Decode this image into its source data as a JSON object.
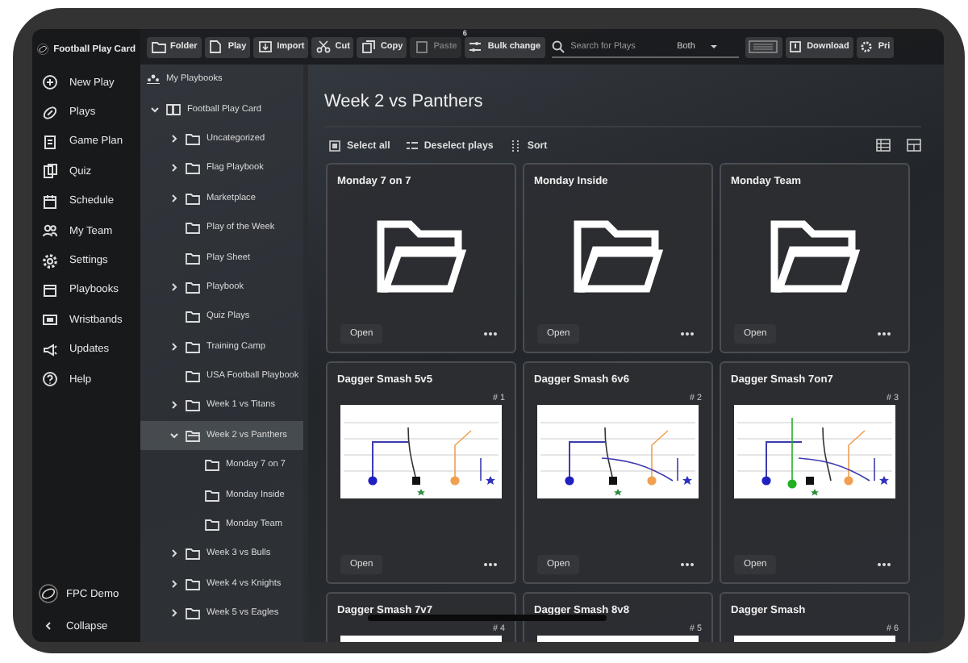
{
  "app": {
    "title": "Football Play Card"
  },
  "nav": {
    "items": [
      {
        "label": "New Play",
        "selected": false
      },
      {
        "label": "Plays",
        "selected": false
      },
      {
        "label": "Game Plan",
        "selected": false
      },
      {
        "label": "Quiz",
        "selected": false
      },
      {
        "label": "Schedule",
        "selected": false
      },
      {
        "label": "My Team",
        "selected": false
      },
      {
        "label": "Settings",
        "selected": false
      },
      {
        "label": "Playbooks",
        "selected": false
      },
      {
        "label": "Wristbands",
        "selected": false
      },
      {
        "label": "Updates",
        "selected": false
      },
      {
        "label": "Help",
        "selected": false
      }
    ],
    "user": "FPC Demo",
    "collapse": "Collapse"
  },
  "toolbar": {
    "buttons": [
      {
        "label": "Folder",
        "disabled": false
      },
      {
        "label": "Play",
        "disabled": false
      },
      {
        "label": "Import",
        "disabled": false
      },
      {
        "label": "Cut",
        "disabled": false
      },
      {
        "label": "Copy",
        "disabled": false
      },
      {
        "label": "Paste",
        "disabled": true
      },
      {
        "label": "Bulk change",
        "disabled": false,
        "badge": "6"
      }
    ],
    "search": {
      "placeholder": "Search for Plays",
      "filter": "Both"
    },
    "right_buttons": [
      {
        "label": "Download"
      },
      {
        "label": "Pri"
      }
    ]
  },
  "tree": {
    "root": "My Playbooks",
    "playbook": {
      "label": "Football Play Card",
      "expanded": true
    },
    "items": [
      {
        "label": "Uncategorized",
        "kind": "expandable",
        "expanded": false,
        "selected": false
      },
      {
        "label": "Flag Playbook",
        "kind": "expandable",
        "expanded": false,
        "selected": false
      },
      {
        "label": "Marketplace",
        "kind": "expandable",
        "expanded": false,
        "selected": false
      },
      {
        "label": "Play of the Week",
        "kind": "leaf",
        "selected": false
      },
      {
        "label": "Play Sheet",
        "kind": "leaf",
        "selected": false
      },
      {
        "label": "Playbook",
        "kind": "expandable",
        "expanded": false,
        "selected": false
      },
      {
        "label": "Quiz Plays",
        "kind": "leaf",
        "selected": false
      },
      {
        "label": "Training Camp",
        "kind": "expandable",
        "expanded": false,
        "selected": false
      },
      {
        "label": "USA Football Playbook",
        "kind": "leaf",
        "selected": false
      },
      {
        "label": "Week 1 vs Titans",
        "kind": "expandable",
        "expanded": false,
        "selected": false
      },
      {
        "label": "Week 2 vs Panthers",
        "kind": "expandable",
        "expanded": true,
        "selected": true,
        "children": [
          {
            "label": "Monday 7 on 7",
            "selected": false
          },
          {
            "label": "Monday Inside",
            "selected": false
          },
          {
            "label": "Monday Team",
            "selected": false
          }
        ]
      },
      {
        "label": "Week 3 vs Bulls",
        "kind": "expandable",
        "expanded": false,
        "selected": false
      },
      {
        "label": "Week 4 vs Knights",
        "kind": "expandable",
        "expanded": false,
        "selected": false
      },
      {
        "label": "Week 5 vs Eagles",
        "kind": "expandable",
        "expanded": false,
        "selected": false
      }
    ]
  },
  "main": {
    "title": "Week 2 vs Panthers",
    "actions": [
      "Select all",
      "Deselect plays",
      "Sort"
    ],
    "folders": [
      {
        "name": "Monday 7 on 7",
        "open": "Open"
      },
      {
        "name": "Monday Inside",
        "open": "Open"
      },
      {
        "name": "Monday Team",
        "open": "Open"
      }
    ],
    "plays": [
      {
        "name": "Dagger Smash 5v5",
        "number": "# 1",
        "open": "Open"
      },
      {
        "name": "Dagger Smash 6v6",
        "number": "# 2",
        "open": "Open"
      },
      {
        "name": "Dagger Smash 7on7",
        "number": "# 3",
        "open": "Open"
      },
      {
        "name": "Dagger Smash 7v7",
        "number": "# 4"
      },
      {
        "name": "Dagger Smash 8v8",
        "number": "# 5"
      },
      {
        "name": "Dagger Smash",
        "number": "# 6"
      }
    ]
  }
}
